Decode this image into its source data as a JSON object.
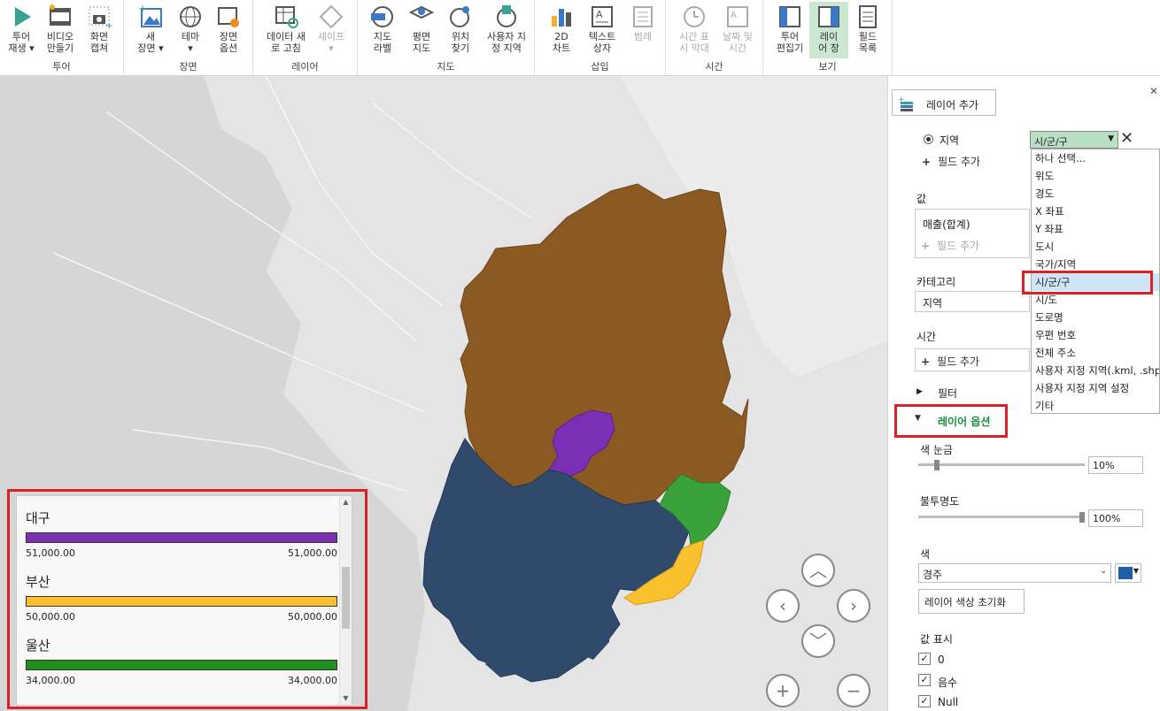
{
  "ribbon": {
    "groups": [
      {
        "label": "투어",
        "buttons": [
          {
            "label": "투어\n재생 ▾",
            "icon": "play-icon"
          },
          {
            "label": "비디오\n만들기",
            "icon": "video-icon"
          },
          {
            "label": "화면\n캡쳐",
            "icon": "camera-icon"
          }
        ]
      },
      {
        "label": "장면",
        "buttons": [
          {
            "label": "새\n장면 ▾",
            "icon": "new-scene-icon"
          },
          {
            "label": "테마\n▾",
            "icon": "globe-theme-icon"
          },
          {
            "label": "장면\n옵션",
            "icon": "scene-options-icon"
          }
        ]
      },
      {
        "label": "레이어",
        "buttons": [
          {
            "label": "데이터 새\n로 고침",
            "icon": "refresh-data-icon"
          },
          {
            "label": "셰이프\n▾",
            "icon": "shape-icon"
          }
        ]
      },
      {
        "label": "지도",
        "buttons": [
          {
            "label": "지도\n라벨",
            "icon": "map-labels-icon"
          },
          {
            "label": "평면\n지도",
            "icon": "flat-map-icon"
          },
          {
            "label": "위치\n찾기",
            "icon": "find-location-icon"
          },
          {
            "label": "사용자 지\n정 지역",
            "icon": "custom-region-icon"
          }
        ]
      },
      {
        "label": "삽입",
        "buttons": [
          {
            "label": "2D\n차트",
            "icon": "chart-2d-icon"
          },
          {
            "label": "텍스트\n상자",
            "icon": "textbox-icon"
          },
          {
            "label": "범례",
            "icon": "legend-icon"
          }
        ]
      },
      {
        "label": "시간",
        "buttons": [
          {
            "label": "시간 표\n시 막대",
            "icon": "time-bar-icon"
          },
          {
            "label": "날짜 및\n시간",
            "icon": "date-time-icon"
          }
        ]
      },
      {
        "label": "보기",
        "buttons": [
          {
            "label": "투어\n편집기",
            "icon": "tour-editor-icon"
          },
          {
            "label": "레이\n어 창",
            "icon": "layer-pane-icon"
          },
          {
            "label": "필드\n목록",
            "icon": "field-list-icon"
          }
        ]
      }
    ]
  },
  "legend": {
    "items": [
      {
        "name": "대구",
        "min": "51,000.00",
        "max": "51,000.00",
        "color": "#7b2fb5"
      },
      {
        "name": "부산",
        "min": "50,000.00",
        "max": "50,000.00",
        "color": "#fbc02d"
      },
      {
        "name": "울산",
        "min": "34,000.00",
        "max": "34,000.00",
        "color": "#1e8e1e"
      }
    ]
  },
  "panel": {
    "add_layer": "레이어 추가",
    "location_label": "지역",
    "location_select": "시/군/구",
    "add_field": "필드 추가",
    "value_label": "값",
    "value_item": "매출(합계)",
    "category_label": "카테고리",
    "category_value": "지역",
    "time_label": "시간",
    "filter_label": "필터",
    "layer_options_label": "레이어 옵션",
    "color_scale_label": "색 눈금",
    "color_scale_value": "10%",
    "opacity_label": "불투명도",
    "opacity_value": "100%",
    "color_label": "색",
    "color_select": "경주",
    "reset_color": "레이어 색상 초기화",
    "show_values_label": "값 표시",
    "checks": [
      "0",
      "음수",
      "Null"
    ],
    "swatch_color": "#1f5fa8"
  },
  "dropdown": {
    "items": [
      "하나 선택...",
      "위도",
      "경도",
      "X 좌표",
      "Y 좌표",
      "도시",
      "국가/지역",
      "시/군/구",
      "시/도",
      "도로명",
      "우편 번호",
      "전체 주소",
      "사용자 지정 지역(.kml, .shp)",
      "사용자 지정 지역 설정",
      "기타"
    ],
    "selected": "시/군/구"
  },
  "map_colors": {
    "gyeongbuk": "#8b5a22",
    "gyeongnam": "#2f4a6b",
    "daegu": "#7b2fb5",
    "ulsan": "#3aa23a",
    "busan": "#fbc02d"
  }
}
